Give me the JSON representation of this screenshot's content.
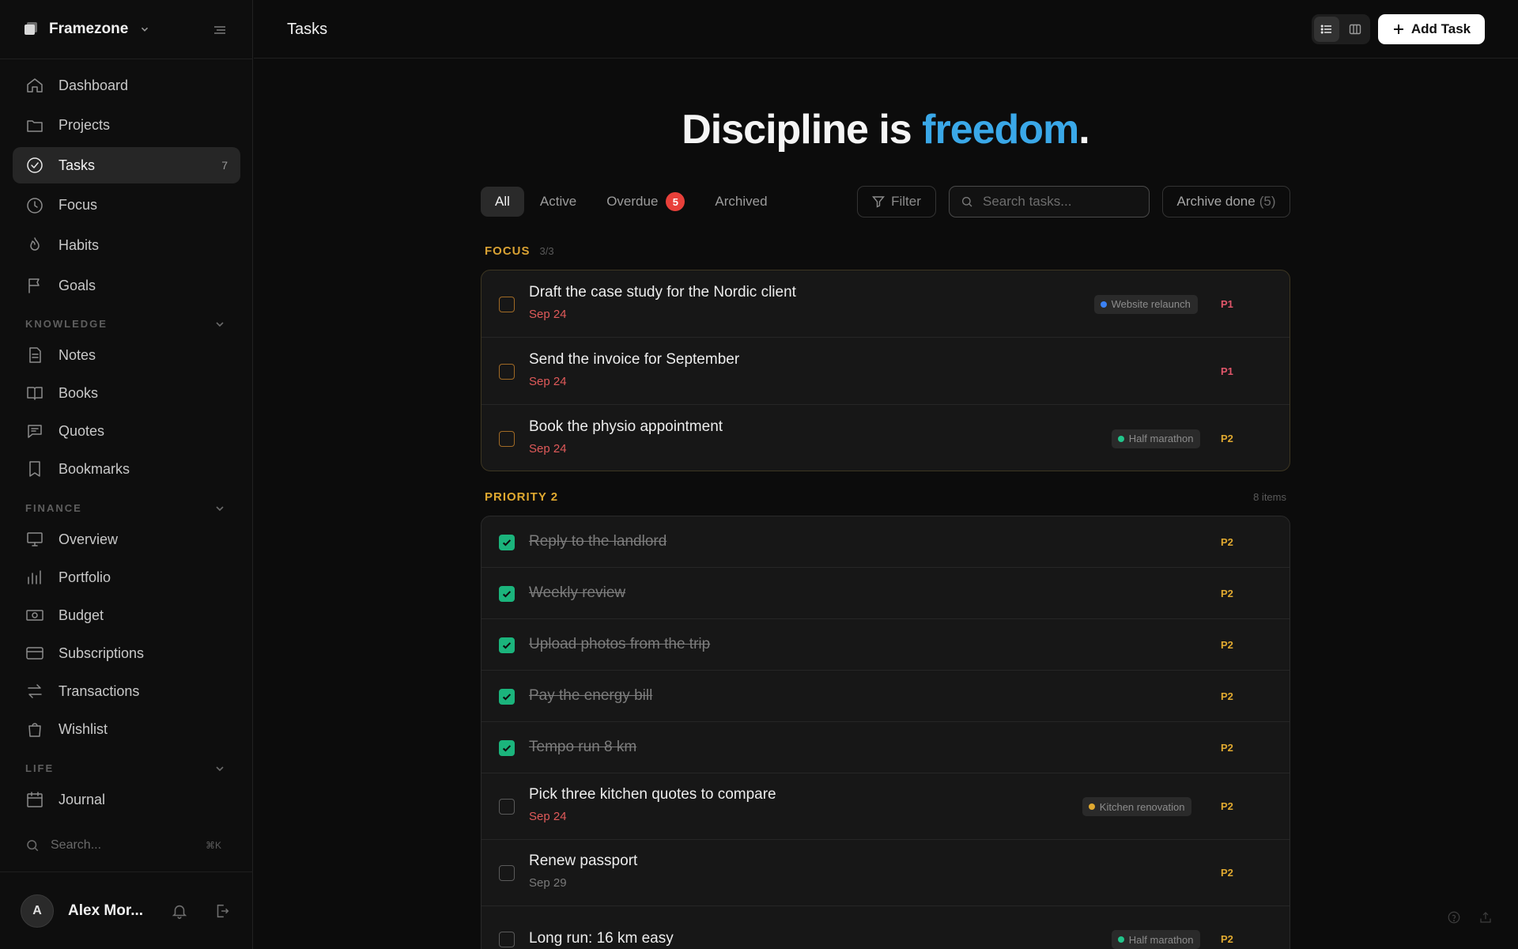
{
  "sidebar": {
    "brand": "Framezone",
    "nav_main": [
      {
        "label": "Dashboard",
        "icon": "home-icon"
      },
      {
        "label": "Projects",
        "icon": "folder-icon"
      },
      {
        "label": "Tasks",
        "icon": "check-circle-icon",
        "count": "7",
        "active": true
      },
      {
        "label": "Focus",
        "icon": "clock-icon"
      },
      {
        "label": "Habits",
        "icon": "flame-icon"
      },
      {
        "label": "Goals",
        "icon": "flag-icon"
      }
    ],
    "sections": {
      "knowledge": "KNOWLEDGE",
      "finance": "FINANCE",
      "life": "LIFE"
    },
    "nav_knowledge": [
      {
        "label": "Notes",
        "icon": "note-icon"
      },
      {
        "label": "Books",
        "icon": "book-icon"
      },
      {
        "label": "Quotes",
        "icon": "quote-icon"
      },
      {
        "label": "Bookmarks",
        "icon": "bookmark-icon"
      }
    ],
    "nav_finance": [
      {
        "label": "Overview",
        "icon": "monitor-icon"
      },
      {
        "label": "Portfolio",
        "icon": "bar-chart-icon"
      },
      {
        "label": "Budget",
        "icon": "banknote-icon"
      },
      {
        "label": "Subscriptions",
        "icon": "credit-card-icon"
      },
      {
        "label": "Transactions",
        "icon": "swap-icon"
      },
      {
        "label": "Wishlist",
        "icon": "shopping-bag-icon"
      }
    ],
    "nav_life": [
      {
        "label": "Journal",
        "icon": "calendar-icon"
      }
    ],
    "search": {
      "placeholder": "Search...",
      "shortcut": "⌘K"
    },
    "user": {
      "initial": "A",
      "name": "Alex Mor..."
    }
  },
  "topbar": {
    "title": "Tasks",
    "add_task_label": "Add Task"
  },
  "main": {
    "headline": {
      "before": "Discipline is ",
      "accent": "freedom",
      "after": "."
    },
    "tabs": [
      {
        "label": "All",
        "active": true
      },
      {
        "label": "Active"
      },
      {
        "label": "Overdue",
        "badge": "5"
      },
      {
        "label": "Archived"
      }
    ],
    "filter_label": "Filter",
    "search_placeholder": "Search tasks...",
    "archive": {
      "label": "Archive done",
      "count": "(5)"
    },
    "groups": {
      "focus": {
        "title": "FOCUS",
        "sub": "3/3",
        "color": "#d9a233"
      },
      "priority2": {
        "title": "PRIORITY 2",
        "right": "8 items",
        "color": "#e0a930"
      }
    },
    "focus_tasks": [
      {
        "title": "Draft the case study for the Nordic client",
        "date": "Sep 24",
        "tag": "Website relaunch",
        "tag_color": "#3b82f6",
        "priority": "P1"
      },
      {
        "title": "Send the invoice for September",
        "date": "Sep 24",
        "priority": "P1"
      },
      {
        "title": "Book the physio appointment",
        "date": "Sep 24",
        "tag": "Half marathon",
        "tag_color": "#22c58b",
        "priority": "P2"
      }
    ],
    "priority2_tasks": [
      {
        "title": "Reply to the landlord",
        "done": true,
        "priority": "P2"
      },
      {
        "title": "Weekly review",
        "done": true,
        "priority": "P2"
      },
      {
        "title": "Upload photos from the trip",
        "done": true,
        "priority": "P2"
      },
      {
        "title": "Pay the energy bill",
        "done": true,
        "priority": "P2"
      },
      {
        "title": "Tempo run 8 km",
        "done": true,
        "priority": "P2"
      },
      {
        "title": "Pick three kitchen quotes to compare",
        "date": "Sep 24",
        "tag": "Kitchen renovation",
        "tag_color": "#e0a930",
        "priority": "P2"
      },
      {
        "title": "Renew passport",
        "date": "Sep 29",
        "priority": "P2"
      },
      {
        "title": "Long run: 16 km easy",
        "tag": "Half marathon",
        "tag_color": "#22c58b",
        "priority": "P2"
      }
    ],
    "colors": {
      "p1": "#e0566a",
      "p2": "#e0a930",
      "overdue_date": "#e05a5a",
      "future_date": "#7a7a7a",
      "accent": "#3aa8e8",
      "done_check": "#1bb47c"
    }
  }
}
